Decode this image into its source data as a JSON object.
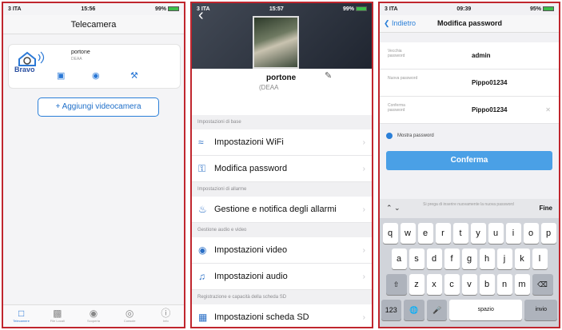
{
  "screen1": {
    "status": {
      "carrier": "3 ITA",
      "time": "15:56",
      "battery": "99%"
    },
    "title": "Telecamera",
    "camera": {
      "name": "portone",
      "sub": "DEAA",
      "logo_text": "Bravo"
    },
    "add_button": "Aggiungi videocamera",
    "tabs": [
      {
        "label": "Telecamere",
        "icon": "camera-icon"
      },
      {
        "label": "File Locali",
        "icon": "gallery-icon"
      },
      {
        "label": "Scoperta",
        "icon": "discover-icon"
      },
      {
        "label": "Console",
        "icon": "console-icon"
      },
      {
        "label": "Info",
        "icon": "info-icon"
      }
    ]
  },
  "screen2": {
    "status": {
      "carrier": "3 ITA",
      "time": "15:57",
      "battery": "99%"
    },
    "name": "portone",
    "sub": "(DEAA",
    "sections": [
      {
        "header": "Impostazioni di base",
        "items": [
          "Impostazioni WiFi",
          "Modifica password"
        ]
      },
      {
        "header": "Impostazioni di allarme",
        "items": [
          "Gestione e notifica degli allarmi"
        ]
      },
      {
        "header": "Gestione audio e video",
        "items": [
          "Impostazioni video",
          "Impostazioni audio"
        ]
      },
      {
        "header": "Registrazione e capacità della scheda SD",
        "items": [
          "Impostazioni scheda SD"
        ]
      }
    ]
  },
  "screen3": {
    "status": {
      "carrier": "3 ITA",
      "time": "09:39",
      "battery": "95%"
    },
    "back": "Indietro",
    "title": "Modifica password",
    "fields": [
      {
        "label": "Vecchia password",
        "value": "admin"
      },
      {
        "label": "Nuova password",
        "value": "Pippo01234"
      },
      {
        "label": "Conferma password",
        "value": "Pippo01234"
      }
    ],
    "show_password": "Mostra password",
    "confirm": "Conferma",
    "kb_hint": "Si prega di inserire nuovamente la nuova password",
    "kb_done": "Fine",
    "kb_rows": [
      [
        "q",
        "w",
        "e",
        "r",
        "t",
        "y",
        "u",
        "i",
        "o",
        "p"
      ],
      [
        "a",
        "s",
        "d",
        "f",
        "g",
        "h",
        "j",
        "k",
        "l"
      ],
      [
        "z",
        "x",
        "c",
        "v",
        "b",
        "n",
        "m"
      ]
    ],
    "kb_space": "spazio",
    "kb_return": "invio",
    "kb_num": "123"
  },
  "colors": {
    "accent": "#2a7fd8",
    "frame": "#c0262e"
  }
}
